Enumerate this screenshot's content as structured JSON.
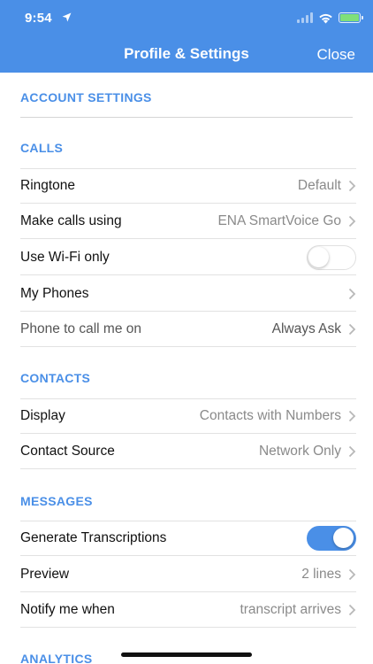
{
  "status_bar": {
    "time": "9:54"
  },
  "header": {
    "title": "Profile & Settings",
    "close_label": "Close"
  },
  "sections": {
    "account": "ACCOUNT SETTINGS",
    "calls": "CALLS",
    "contacts": "CONTACTS",
    "messages": "MESSAGES",
    "analytics": "ANALYTICS"
  },
  "calls": {
    "ringtone": {
      "label": "Ringtone",
      "value": "Default"
    },
    "make_calls": {
      "label": "Make calls using",
      "value": "ENA SmartVoice Go"
    },
    "wifi_only": {
      "label": "Use Wi-Fi only",
      "enabled": false
    },
    "my_phones": {
      "label": "My Phones"
    },
    "phone_to_call": {
      "label": "Phone to call me on",
      "value": "Always Ask"
    }
  },
  "contacts": {
    "display": {
      "label": "Display",
      "value": "Contacts with Numbers"
    },
    "source": {
      "label": "Contact Source",
      "value": "Network Only"
    }
  },
  "messages": {
    "transcriptions": {
      "label": "Generate Transcriptions",
      "enabled": true
    },
    "preview": {
      "label": "Preview",
      "value": "2 lines"
    },
    "notify": {
      "label": "Notify me when",
      "value": "transcript arrives"
    }
  },
  "colors": {
    "accent": "#4a8fe7",
    "toggle_on": "#4a8fe7"
  }
}
